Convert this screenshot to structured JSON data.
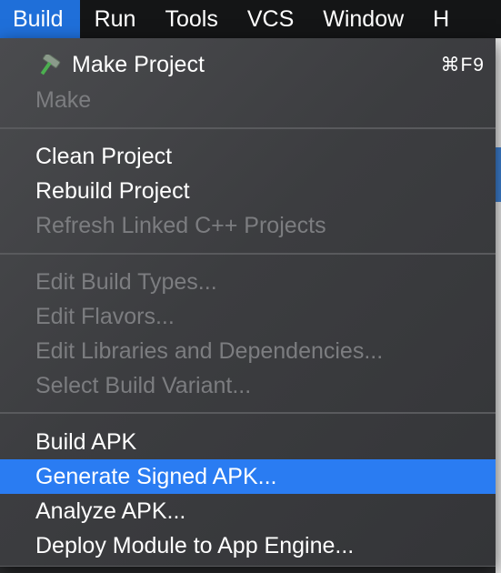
{
  "menubar": {
    "items": [
      {
        "label": "Build"
      },
      {
        "label": "Run"
      },
      {
        "label": "Tools"
      },
      {
        "label": "VCS"
      },
      {
        "label": "Window"
      },
      {
        "label": "H"
      }
    ]
  },
  "menu": {
    "items": [
      {
        "label": "Make Project",
        "shortcut": "⌘F9",
        "icon": "hammer-icon",
        "enabled": true
      },
      {
        "label": "Make",
        "enabled": false
      },
      {
        "label": "Clean Project",
        "enabled": true
      },
      {
        "label": "Rebuild Project",
        "enabled": true
      },
      {
        "label": "Refresh Linked C++ Projects",
        "enabled": false
      },
      {
        "label": "Edit Build Types...",
        "enabled": false
      },
      {
        "label": "Edit Flavors...",
        "enabled": false
      },
      {
        "label": "Edit Libraries and Dependencies...",
        "enabled": false
      },
      {
        "label": "Select Build Variant...",
        "enabled": false
      },
      {
        "label": "Build APK",
        "enabled": true
      },
      {
        "label": "Generate Signed APK...",
        "enabled": true,
        "highlighted": true
      },
      {
        "label": "Analyze APK...",
        "enabled": true
      },
      {
        "label": "Deploy Module to App Engine...",
        "enabled": true
      }
    ]
  },
  "colors": {
    "menubar_bg": "#141516",
    "active_menu": "#1f6fd9",
    "highlight": "#2a7cf2",
    "disabled_text": "#7c7d80",
    "hammer_head": "#7a8a7a",
    "hammer_handle": "#4caf50"
  }
}
